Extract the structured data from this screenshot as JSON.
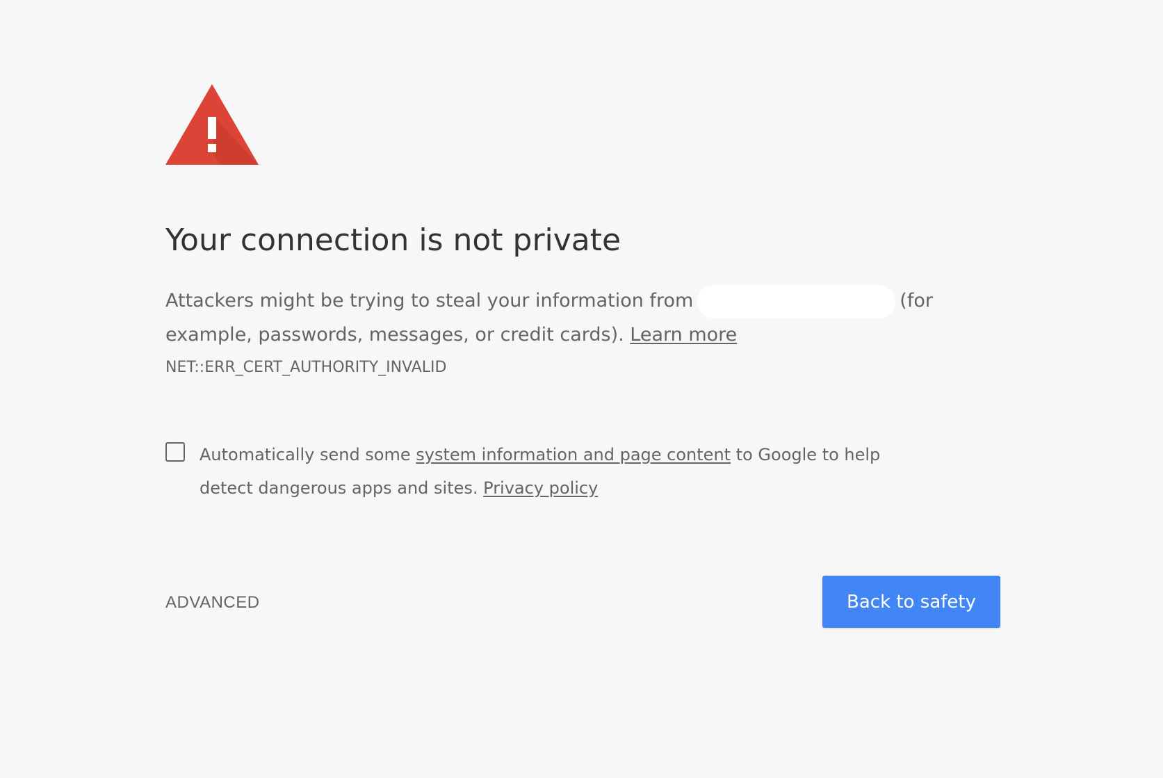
{
  "interstitial": {
    "heading": "Your connection is not private",
    "explanation": {
      "part1": "Attackers might be trying to steal your information from",
      "part2": "(for example, passwords, messages, or credit cards).",
      "learn_more": "Learn more"
    },
    "error_code": "NET::ERR_CERT_AUTHORITY_INVALID",
    "optin": {
      "checked": false,
      "text_before": "Automatically send some",
      "link_system_info": "system information and page content",
      "text_middle": "to Google to help detect dangerous apps and sites.",
      "link_privacy": "Privacy policy"
    },
    "advanced_label": "ADVANCED",
    "primary_label": "Back to safety"
  },
  "colors": {
    "background": "#f7f7f7",
    "warning_red": "#db4437",
    "primary_blue": "#4285f4",
    "heading_text": "#333333",
    "body_text": "#646464"
  },
  "icons": {
    "warning": "warning-triangle-icon"
  }
}
